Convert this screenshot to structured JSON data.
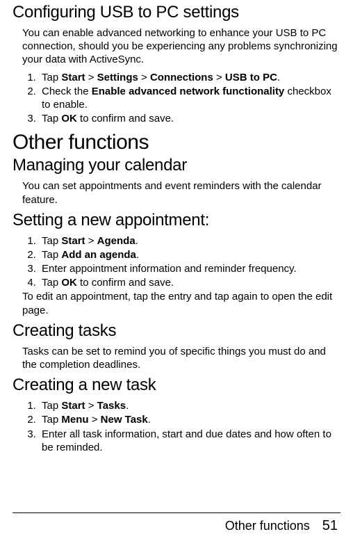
{
  "section1": {
    "heading": "Configuring USB to PC settings",
    "intro": "You can enable advanced networking to enhance your USB to PC connection, should you be experiencing any problems syn­chronizing your data with ActiveSync.",
    "steps": {
      "s1a": "Tap ",
      "s1b": "Start",
      "s1c": " > ",
      "s1d": "Settings",
      "s1e": " > ",
      "s1f": "Connections",
      "s1g": " > ",
      "s1h": "USB to PC",
      "s1i": ".",
      "s2a": "Check the ",
      "s2b": "Enable advanced network functionality",
      "s2c": " checkbox to enable.",
      "s3a": "Tap ",
      "s3b": "OK",
      "s3c": " to confirm and save."
    }
  },
  "major_heading": "Other functions",
  "section2": {
    "heading": "Managing your calendar",
    "intro": "You can set appointments and event reminders with the calen­dar feature."
  },
  "section3": {
    "heading": "Setting a new appointment:",
    "steps": {
      "s1a": "Tap ",
      "s1b": "Start",
      "s1c": " > ",
      "s1d": "Agenda",
      "s1e": ".",
      "s2a": "Tap ",
      "s2b": "Add an agenda",
      "s2c": ".",
      "s3": "Enter appointment information and reminder frequency.",
      "s4a": "Tap ",
      "s4b": "OK",
      "s4c": " to confirm and save."
    },
    "note": "To edit an appointment, tap the entry and tap again to open the edit page."
  },
  "section4": {
    "heading": "Creating tasks",
    "intro": "Tasks can be set to remind you of specific things you must do and the completion deadlines."
  },
  "section5": {
    "heading": "Creating a new task",
    "steps": {
      "s1a": "Tap ",
      "s1b": "Start",
      "s1c": " > ",
      "s1d": "Tasks",
      "s1e": ".",
      "s2a": "Tap ",
      "s2b": "Menu",
      "s2c": " > ",
      "s2d": "New Task",
      "s2e": ".",
      "s3": "Enter all task information, start and due dates and how often to be reminded."
    }
  },
  "footer": {
    "title": "Other functions",
    "page": "51"
  }
}
